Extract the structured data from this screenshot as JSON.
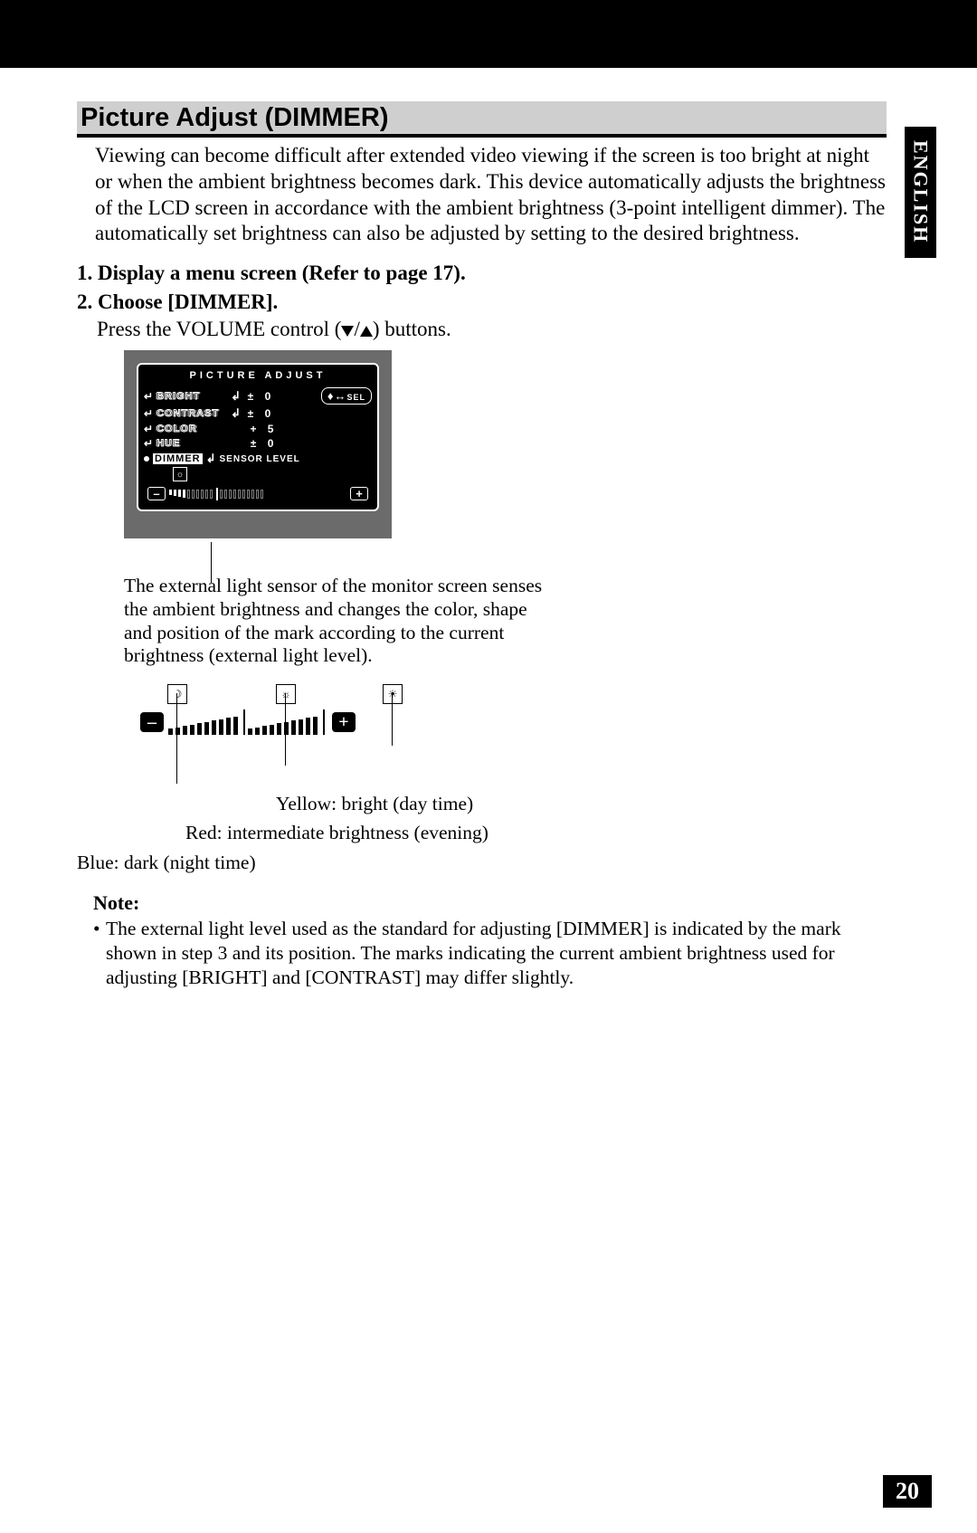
{
  "language_tab": "ENGLISH",
  "section_title": "Picture Adjust (DIMMER)",
  "intro": "Viewing can become difficult after extended video viewing if the screen is too bright at night or when the ambient brightness becomes dark. This device automatically adjusts the brightness of the LCD screen in accordance with the ambient brightness (3-point intelligent dimmer). The automatically set brightness can also be adjusted by setting to the desired brightness.",
  "steps": {
    "s1": "1.  Display a menu screen (Refer to page 17).",
    "s2": "2.  Choose [DIMMER].",
    "s2_text_before": "Press the VOLUME control (",
    "s2_text_after": ") buttons."
  },
  "osd": {
    "title": "PICTURE ADJUST",
    "rows": [
      {
        "label": "BRIGHT",
        "pm": "±",
        "val": "0"
      },
      {
        "label": "CONTRAST",
        "pm": "±",
        "val": "0"
      },
      {
        "label": "COLOR",
        "pm": "+",
        "val": "5"
      },
      {
        "label": "HUE",
        "pm": "±",
        "val": "0"
      }
    ],
    "sel_label": "SEL",
    "dimmer_label": "DIMMER",
    "sensor_label": "SENSOR LEVEL",
    "minus": "–",
    "plus": "+"
  },
  "caption": "The external light sensor of the monitor screen senses the ambient brightness and changes the color, shape and position of the mark according to the current brightness (external light level).",
  "color_legend": {
    "yellow": "Yellow: bright (day time)",
    "red": "Red: intermediate brightness (evening)",
    "blue": "Blue: dark (night time)"
  },
  "note_header": "Note:",
  "note_text": "The external light level used as the standard for adjusting [DIMMER] is indicated by the mark shown in step 3 and its position. The marks indicating the current ambient brightness used for adjusting [BRIGHT] and [CONTRAST] may differ slightly.",
  "page_number": "20"
}
